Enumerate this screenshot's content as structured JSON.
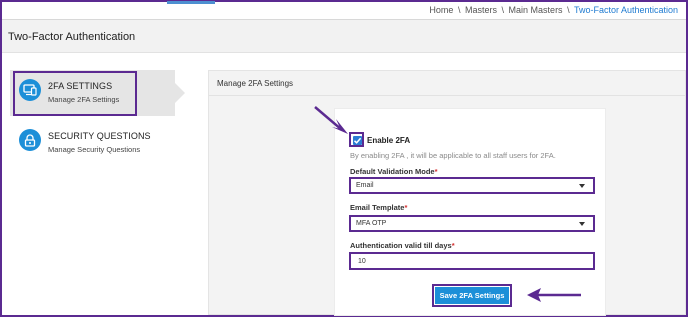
{
  "breadcrumb": {
    "items": [
      "Home",
      "Masters",
      "Main Masters"
    ],
    "separator": "\\",
    "active": "Two-Factor Authentication"
  },
  "page": {
    "title": "Two-Factor Authentication"
  },
  "sidebar": {
    "items": [
      {
        "title": "2FA SETTINGS",
        "subtitle": "Manage 2FA Settings",
        "icon": "devices-icon",
        "active": true
      },
      {
        "title": "SECURITY QUESTIONS",
        "subtitle": "Manage Security Questions",
        "icon": "lock-icon",
        "active": false
      }
    ]
  },
  "panel": {
    "title": "Manage 2FA Settings",
    "enable_label": "Enable 2FA",
    "enable_checked": true,
    "help_text": "By enabling 2FA , it will be applicable to all staff users for 2FA.",
    "validation_mode": {
      "label": "Default Validation Mode",
      "required_mark": "*",
      "value": "Email"
    },
    "email_template": {
      "label": "Email Template",
      "required_mark": "*",
      "value": "MFA OTP"
    },
    "valid_days": {
      "label": "Authentication valid till days",
      "required_mark": "*",
      "value": "10"
    },
    "save_label": "Save 2FA Settings"
  },
  "colors": {
    "highlight": "#5b2a91",
    "primary": "#1c8fd8",
    "link": "#1f7bd1",
    "required": "#d32f2f"
  }
}
